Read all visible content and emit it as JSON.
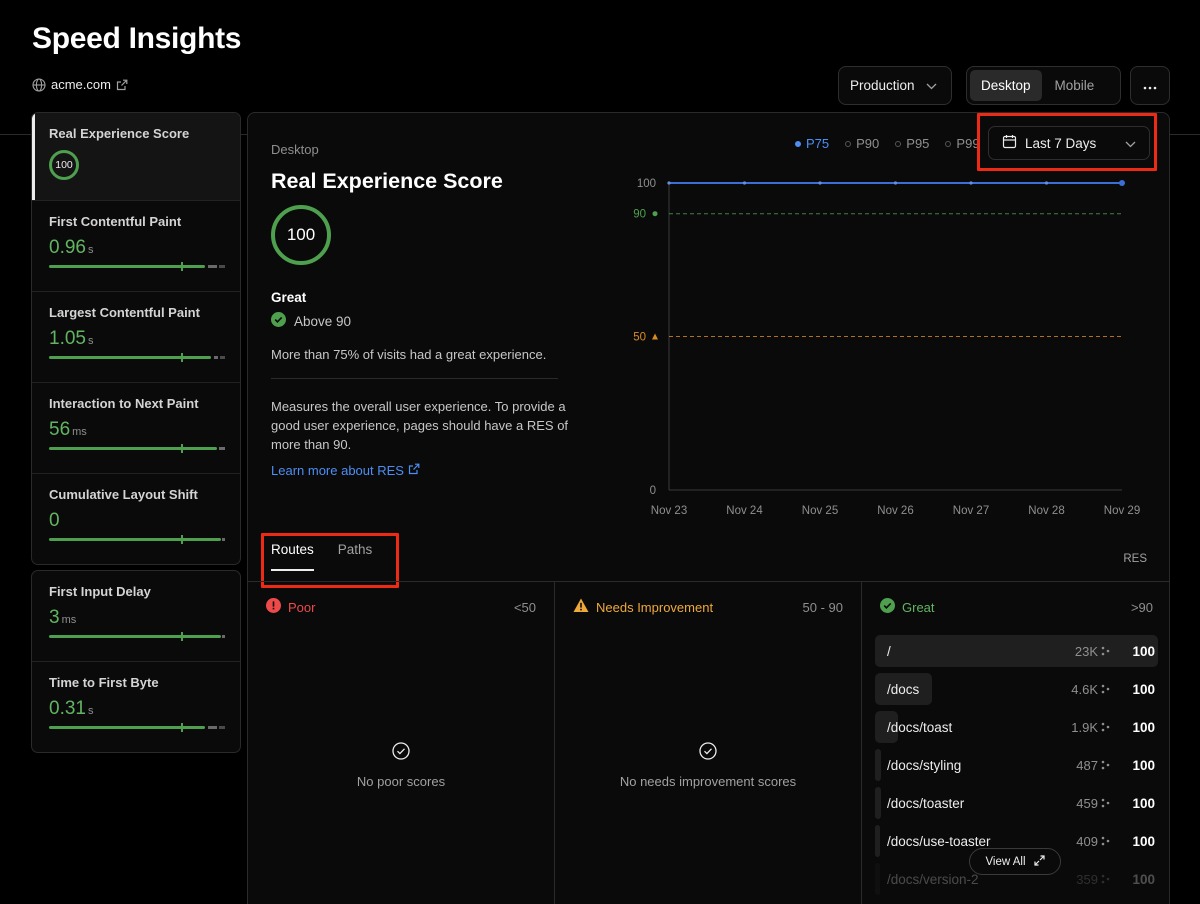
{
  "header": {
    "title": "Speed Insights",
    "site": "acme.com",
    "environment": "Production",
    "device_options": [
      "Desktop",
      "Mobile"
    ],
    "device_selected": "Desktop",
    "more_icon": "ellipsis-icon"
  },
  "sidebar": {
    "metrics": [
      {
        "label": "Real Experience Score",
        "score": "100"
      },
      {
        "label": "First Contentful Paint",
        "value": "0.96",
        "unit": "s"
      },
      {
        "label": "Largest Contentful Paint",
        "value": "1.05",
        "unit": "s"
      },
      {
        "label": "Interaction to Next Paint",
        "value": "56",
        "unit": "ms"
      },
      {
        "label": "Cumulative Layout Shift",
        "value": "0",
        "unit": ""
      }
    ],
    "other_metrics": [
      {
        "label": "First Input Delay",
        "value": "3",
        "unit": "ms"
      },
      {
        "label": "Time to First Byte",
        "value": "0.31",
        "unit": "s"
      }
    ]
  },
  "detail": {
    "device": "Desktop",
    "title": "Real Experience Score",
    "score": "100",
    "rating": "Great",
    "rating_detail": "Above 90",
    "visits_text": "More than 75% of visits had a great experience.",
    "description": "Measures the overall user experience. To provide a good user experience, pages should have a RES of more than 90.",
    "learn_more": "Learn more about RES",
    "percentiles": [
      "P75",
      "P90",
      "P95",
      "P99"
    ],
    "percentile_selected": "P75",
    "date_range": "Last 7 Days"
  },
  "chart_data": {
    "type": "line",
    "x": [
      "Nov 23",
      "Nov 24",
      "Nov 25",
      "Nov 26",
      "Nov 27",
      "Nov 28",
      "Nov 29"
    ],
    "series": [
      {
        "name": "P75",
        "values": [
          100,
          100,
          100,
          100,
          100,
          100,
          100
        ]
      }
    ],
    "thresholds": [
      {
        "label": "90",
        "value": 90,
        "color": "#4ea04e"
      },
      {
        "label": "50",
        "value": 50,
        "color": "#d98a25"
      }
    ],
    "yticks": [
      "100",
      "0"
    ],
    "ylim": [
      0,
      100
    ],
    "series_color": "#3a6fd8"
  },
  "tabs": {
    "items": [
      "Routes",
      "Paths"
    ],
    "selected": "Routes",
    "column_label": "RES"
  },
  "buckets": {
    "poor": {
      "name": "Poor",
      "range": "<50",
      "empty": "No poor scores"
    },
    "needs_improvement": {
      "name": "Needs Improvement",
      "range": "50 - 90",
      "empty": "No needs improvement scores"
    },
    "great": {
      "name": "Great",
      "range": ">90",
      "routes": [
        {
          "path": "/",
          "count": "23K",
          "score": "100",
          "share": 1.0
        },
        {
          "path": "/docs",
          "count": "4.6K",
          "score": "100",
          "share": 0.2
        },
        {
          "path": "/docs/toast",
          "count": "1.9K",
          "score": "100",
          "share": 0.083
        },
        {
          "path": "/docs/styling",
          "count": "487",
          "score": "100",
          "share": 0.021
        },
        {
          "path": "/docs/toaster",
          "count": "459",
          "score": "100",
          "share": 0.02
        },
        {
          "path": "/docs/use-toaster",
          "count": "409",
          "score": "100",
          "share": 0.018
        },
        {
          "path": "/docs/version-2",
          "count": "359",
          "score": "100",
          "share": 0.016
        }
      ]
    }
  },
  "view_all": "View All"
}
